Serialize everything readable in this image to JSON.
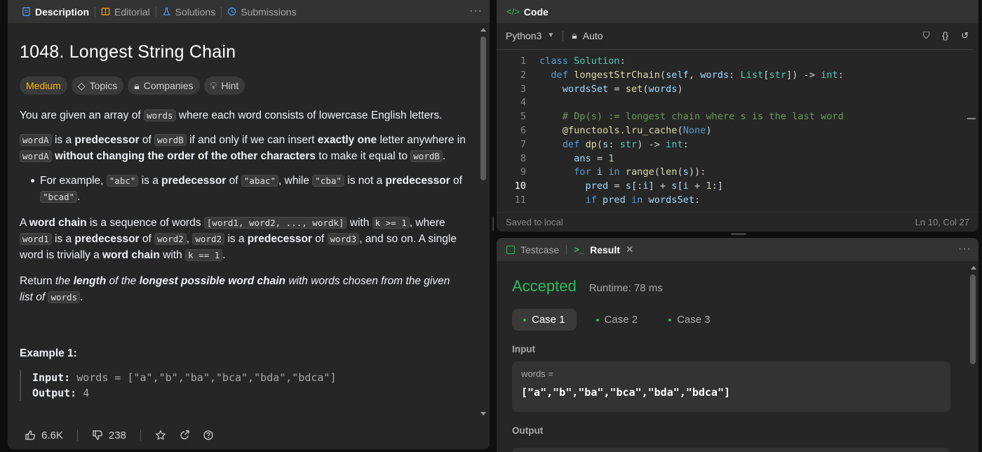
{
  "left_tabs": [
    {
      "label": "Description"
    },
    {
      "label": "Editorial"
    },
    {
      "label": "Solutions"
    },
    {
      "label": "Submissions"
    }
  ],
  "problem": {
    "title": "1048. Longest String Chain",
    "difficulty": "Medium",
    "chips": [
      "Topics",
      "Companies",
      "Hint"
    ]
  },
  "description": {
    "p1_a": "You are given an array of ",
    "p1_code": "words",
    "p1_b": " where each word consists of lowercase English letters.",
    "word_a": "wordA",
    "word_b": "wordB",
    "is_a": " is a ",
    "predecessor": "predecessor",
    "of": " of ",
    "p2_a": " if and only if we can insert ",
    "exactly_one": "exactly one",
    "p2_b": " letter anywhere in ",
    "without_changing": "without changing the order of the other characters",
    "p2_c": " to make it equal to ",
    "period": ".",
    "bullet_a": "For example, ",
    "abc": "\"abc\"",
    "abac": "\"abac\"",
    "while": ", while ",
    "cba": "\"cba\"",
    "is_not_a": " is not a ",
    "bcad": "\"bcad\"",
    "p3_a": "A ",
    "word_chain": "word chain",
    "p3_b": " is a sequence of words ",
    "seq_code": "[word1, word2, ..., wordk]",
    "with": " with ",
    "k_ge": "k >= 1",
    "where": ", where ",
    "word1": "word1",
    "word2": "word2",
    "word3": "word3",
    "comma": ", ",
    "and_so_on": ", and so on. A single word is trivially a ",
    "with2": " with ",
    "k_eq": "k == 1",
    "p4_a": "Return ",
    "the": "the ",
    "length": "length",
    "of_the": " of the ",
    "longest_possible": "longest possible word chain",
    "p4_b": " with words chosen from the given list of ",
    "words": "words",
    "example_title": "Example 1:",
    "input_label": "Input:",
    "input_value": " words = [\"a\",\"b\",\"ba\",\"bca\",\"bda\",\"bdca\"]",
    "output_label": "Output:",
    "output_value": " 4"
  },
  "footer": {
    "likes": "6.6K",
    "dislikes": "238"
  },
  "code_panel": {
    "title": "Code",
    "language": "Python3",
    "mode": "Auto",
    "status_left": "Saved to local",
    "status_right": "Ln 10, Col 27",
    "lines": [
      "1",
      "2",
      "3",
      "4",
      "5",
      "6",
      "7",
      "8",
      "9",
      "10",
      "11"
    ]
  },
  "result_panel": {
    "tab_testcase": "Testcase",
    "tab_result": "Result",
    "verdict": "Accepted",
    "runtime": "Runtime: 78 ms",
    "cases": [
      "Case 1",
      "Case 2",
      "Case 3"
    ],
    "input_label": "Input",
    "var_name": "words =",
    "var_value": "[\"a\",\"b\",\"ba\",\"bca\",\"bda\",\"bdca\"]",
    "output_label": "Output"
  },
  "colors": {
    "accepted": "#2cbb5d",
    "medium": "#ffb800",
    "active_tab": "#ffffff"
  }
}
